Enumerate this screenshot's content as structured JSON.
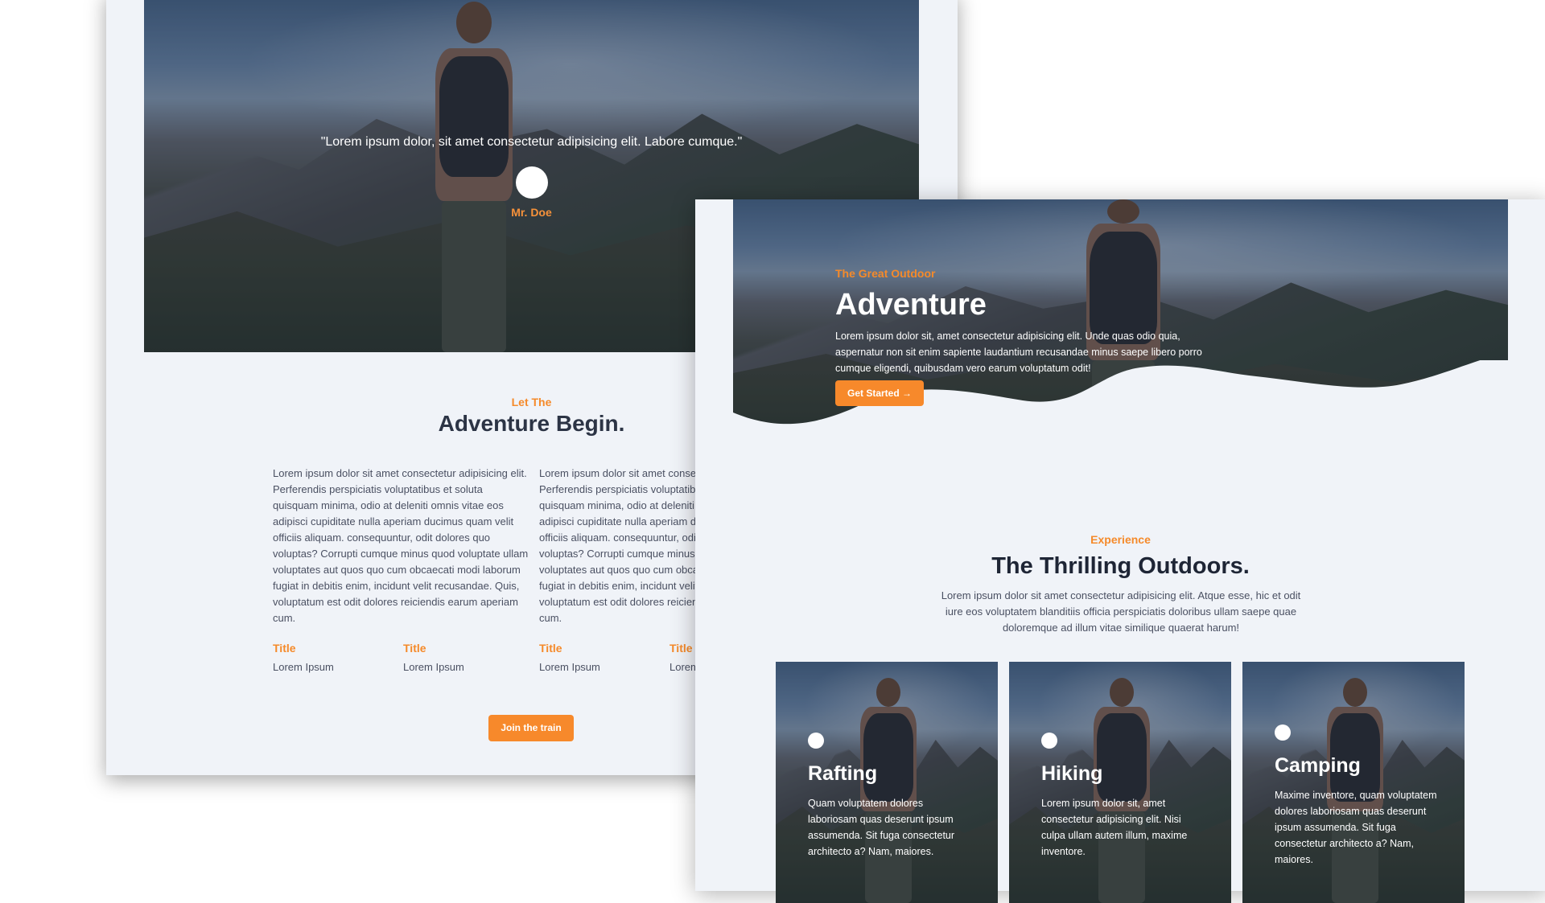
{
  "back_page": {
    "quote": "\"Lorem ipsum dolor, sit amet consectetur adipisicing elit. Labore cumque.\"",
    "author": "Mr. Doe",
    "eyebrow": "Let The",
    "heading": "Adventure Begin.",
    "columns": [
      "Lorem ipsum dolor sit amet consectetur adipisicing elit. Perferendis perspiciatis voluptatibus et soluta quisquam minima, odio at deleniti omnis vitae eos adipisci cupiditate nulla aperiam ducimus quam velit officiis aliquam. consequuntur, odit dolores quo voluptas? Corrupti cumque minus quod voluptate ullam voluptates aut quos quo cum obcaecati modi laborum fugiat in debitis enim, incidunt velit recusandae. Quis, voluptatum est odit dolores reiciendis earum aperiam cum.",
      "Lorem ipsum dolor sit amet consectetur adipisicing elit. Perferendis perspiciatis voluptatibus et soluta quisquam minima, odio at deleniti omnis vitae eos adipisci cupiditate nulla aperiam ducimus quam velit officiis aliquam. consequuntur, odit dolores quo voluptas? Corrupti cumque minus quod voluptate ullam voluptates aut quos quo cum obcaecati modi laborum fugiat in debitis enim, incidunt velit recusandae. Quis, voluptatum est odit dolores reiciendis earum aperiam cum."
    ],
    "stats": [
      {
        "title": "Title",
        "value": "Lorem Ipsum"
      },
      {
        "title": "Title",
        "value": "Lorem Ipsum"
      },
      {
        "title": "Title",
        "value": "Lorem Ipsum"
      },
      {
        "title": "Title",
        "value": "Lorem Ipsum"
      }
    ],
    "button": "Join the train"
  },
  "front_page": {
    "eyebrow": "The Great Outdoor",
    "title": "Adventure",
    "body": "Lorem ipsum dolor sit, amet consectetur adipisicing elit. Unde quas odio quia, aspernatur non sit enim sapiente laudantium recusandae minus saepe libero porro cumque eligendi, quibusdam vero earum voluptatum odit!",
    "button": "Get Started →",
    "section_eyebrow": "Experience",
    "section_heading": "The Thrilling Outdoors.",
    "section_body": "Lorem ipsum dolor sit amet consectetur adipisicing elit. Atque esse, hic et odit iure eos voluptatem blanditiis officia perspiciatis doloribus ullam saepe quae doloremque ad illum vitae similique quaerat harum!",
    "cards": [
      {
        "title": "Rafting",
        "body": "Quam voluptatem dolores laboriosam quas deserunt ipsum assumenda. Sit fuga consectetur architecto a? Nam, maiores."
      },
      {
        "title": "Hiking",
        "body": "Lorem ipsum dolor sit, amet consectetur adipisicing elit. Nisi culpa ullam autem illum, maxime inventore."
      },
      {
        "title": "Camping",
        "body": "Maxime inventore, quam voluptatem dolores laboriosam quas deserunt ipsum assumenda. Sit fuga consectetur architecto a? Nam, maiores."
      }
    ]
  },
  "colors": {
    "accent": "#f7892b",
    "page_bg": "#f0f3f8",
    "heading": "#2c3445"
  }
}
